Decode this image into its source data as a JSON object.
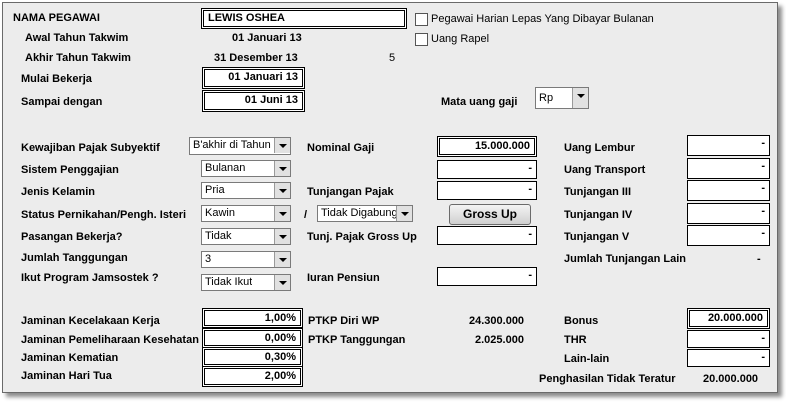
{
  "employee": {
    "name_label": "NAMA PEGAWAI",
    "name_value": "LEWIS OSHEA",
    "start_year_label": "Awal Tahun Takwim",
    "start_year_value": "01 Januari 13",
    "end_year_label": "Akhir Tahun Takwim",
    "end_year_value": "31 Desember 13",
    "period_count": "5",
    "work_start_label": "Mulai Bekerja",
    "work_start_value": "01 Januari 13",
    "work_end_label": "Sampai dengan",
    "work_end_value": "01 Juni 13"
  },
  "options": {
    "harian_label": "Pegawai Harian Lepas Yang Dibayar Bulanan",
    "rapel_label": "Uang Rapel",
    "currency_label": "Mata uang gaji",
    "currency_value": "Rp"
  },
  "left_fields": {
    "tax_subject_label": "Kewajiban Pajak Subyektif",
    "tax_subject_value": "B'akhir di Tahun B",
    "pay_system_label": "Sistem Penggajian",
    "pay_system_value": "Bulanan",
    "gender_label": "Jenis Kelamin",
    "gender_value": "Pria",
    "marital_label": "Status Pernikahan/Pengh. Isteri",
    "marital_value": "Kawin",
    "marital_separator": "/",
    "combined_value": "Tidak Digabung",
    "spouse_label": "Pasangan Bekerja?",
    "spouse_value": "Tidak",
    "dependents_label": "Jumlah Tanggungan",
    "dependents_value": "3",
    "jamsostek_label": "Ikut Program Jamsostek ?",
    "jamsostek_value": "Tidak Ikut"
  },
  "middle_fields": {
    "salary_label": "Nominal Gaji",
    "salary_value": "15.000.000",
    "row2_value": "-",
    "tax_allowance_label": "Tunjangan Pajak",
    "tax_allowance_value": "-",
    "grossup_button": "Gross Up",
    "grossup_tax_label": "Tunj. Pajak Gross Up",
    "grossup_tax_value": "-",
    "pension_label": "Iuran Pensiun",
    "pension_value": "-"
  },
  "right_fields": {
    "overtime_label": "Uang Lembur",
    "overtime_value": "-",
    "transport_label": "Uang Transport",
    "transport_value": "-",
    "allow3_label": "Tunjangan III",
    "allow3_value": "-",
    "allow4_label": "Tunjangan IV",
    "allow4_value": "-",
    "allow5_label": "Tunjangan V",
    "allow5_value": "-",
    "other_allow_label": "Jumlah Tunjangan Lain",
    "other_allow_value": "-"
  },
  "insurance": {
    "jkk_label": "Jaminan Kecelakaan Kerja",
    "jkk_value": "1,00%",
    "jpk_label": "Jaminan Pemeliharaan Kesehatan",
    "jpk_value": "0,00%",
    "jkm_label": "Jaminan Kematian",
    "jkm_value": "0,30%",
    "jht_label": "Jaminan Hari Tua",
    "jht_value": "2,00%"
  },
  "ptkp": {
    "self_label": "PTKP Diri WP",
    "self_value": "24.300.000",
    "dependents_label": "PTKP Tanggungan",
    "dependents_value": "2.025.000"
  },
  "irregular": {
    "bonus_label": "Bonus",
    "bonus_value": "20.000.000",
    "thr_label": "THR",
    "thr_value": "-",
    "other_label": "Lain-lain",
    "other_value": "-",
    "total_label": "Penghasilan Tidak Teratur",
    "total_value": "20.000.000"
  }
}
